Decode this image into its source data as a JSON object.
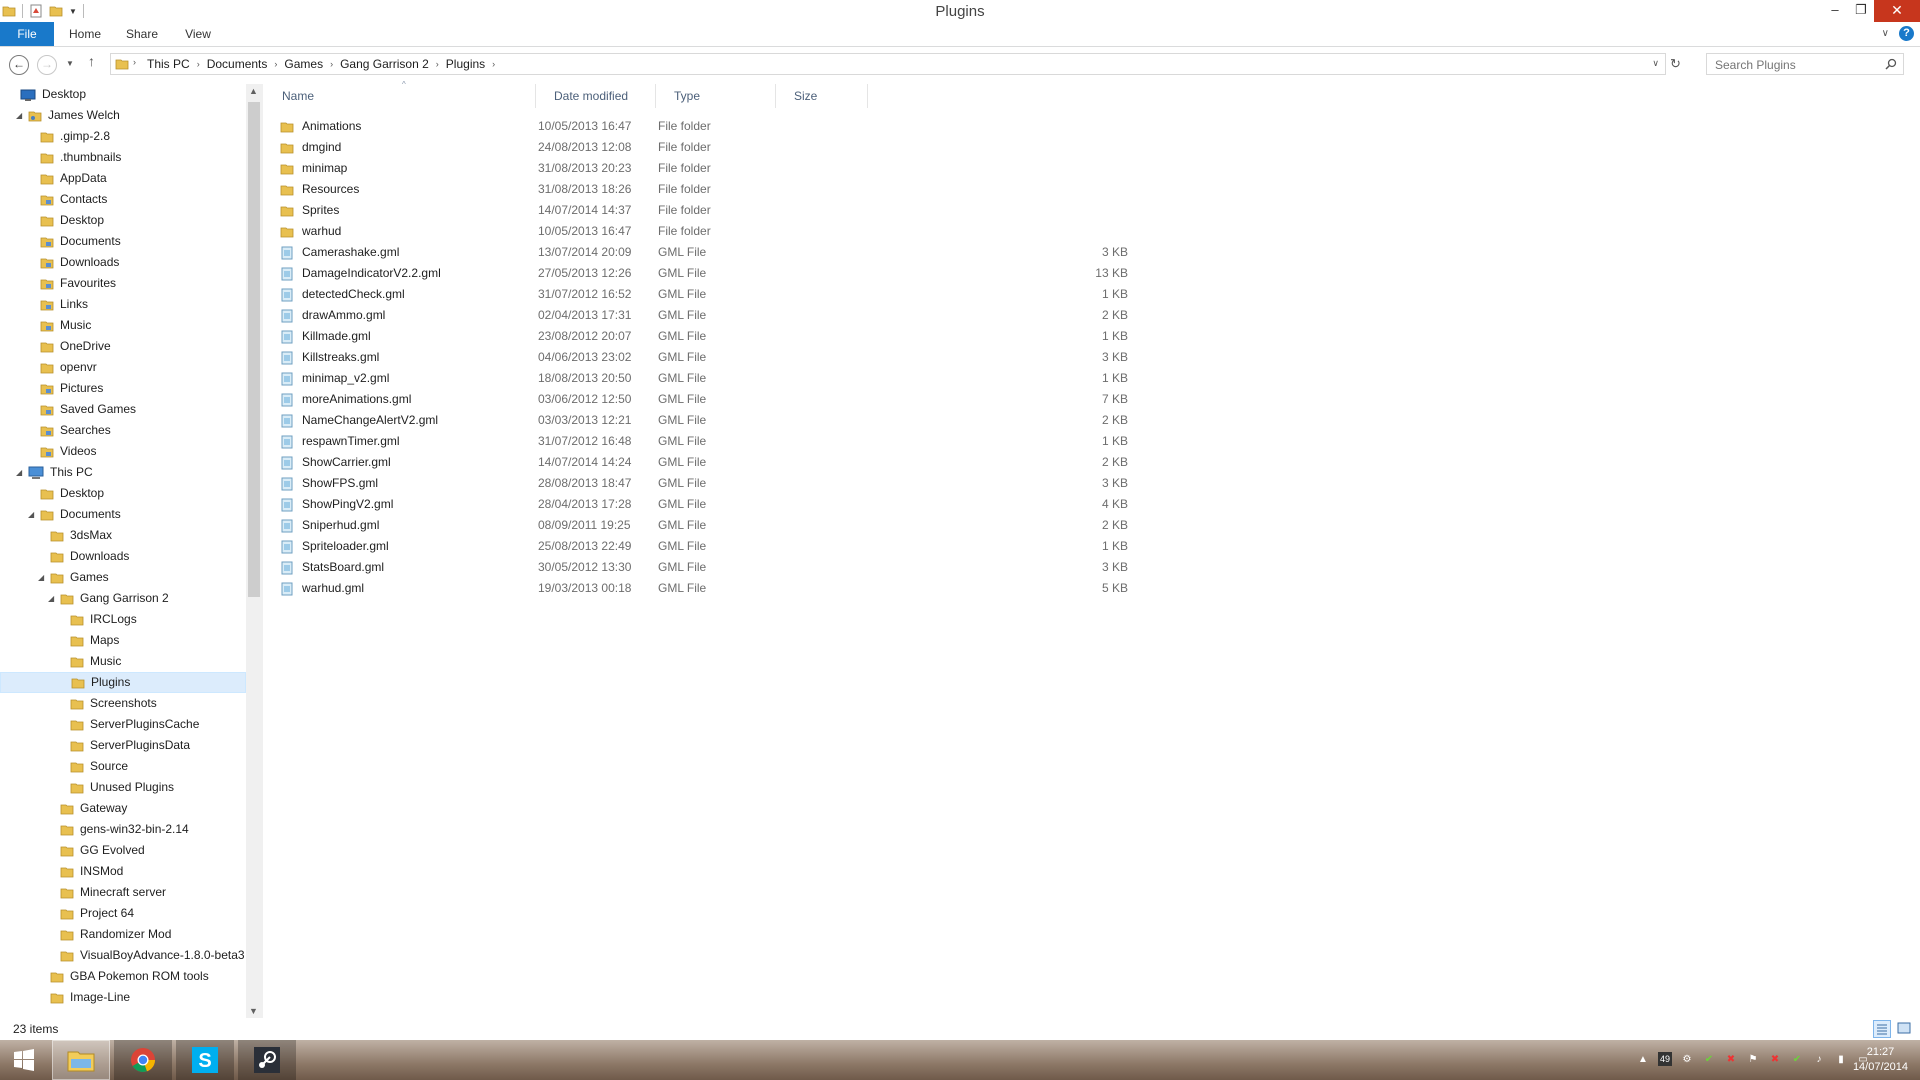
{
  "window": {
    "title": "Plugins"
  },
  "ribbon": {
    "tabs": [
      "File",
      "Home",
      "Share",
      "View"
    ]
  },
  "address": {
    "breadcrumbs": [
      "This PC",
      "Documents",
      "Games",
      "Gang Garrison 2",
      "Plugins"
    ],
    "search_placeholder": "Search Plugins"
  },
  "columns": {
    "name": "Name",
    "date": "Date modified",
    "type": "Type",
    "size": "Size"
  },
  "nav_tree": [
    {
      "label": "Desktop",
      "icon": "desktop-icon"
    },
    {
      "label": "James Welch",
      "icon": "user-folder-icon"
    },
    {
      "label": ".gimp-2.8",
      "icon": "folder-icon"
    },
    {
      "label": ".thumbnails",
      "icon": "folder-icon"
    },
    {
      "label": "AppData",
      "icon": "folder-icon"
    },
    {
      "label": "Contacts",
      "icon": "contacts-icon"
    },
    {
      "label": "Desktop",
      "icon": "folder-icon"
    },
    {
      "label": "Documents",
      "icon": "documents-icon"
    },
    {
      "label": "Downloads",
      "icon": "downloads-icon"
    },
    {
      "label": "Favourites",
      "icon": "favourites-icon"
    },
    {
      "label": "Links",
      "icon": "links-icon"
    },
    {
      "label": "Music",
      "icon": "music-icon"
    },
    {
      "label": "OneDrive",
      "icon": "folder-icon"
    },
    {
      "label": "openvr",
      "icon": "folder-icon"
    },
    {
      "label": "Pictures",
      "icon": "pictures-icon"
    },
    {
      "label": "Saved Games",
      "icon": "saved-games-icon"
    },
    {
      "label": "Searches",
      "icon": "searches-icon"
    },
    {
      "label": "Videos",
      "icon": "videos-icon"
    },
    {
      "label": "This PC",
      "icon": "computer-icon"
    },
    {
      "label": "Desktop",
      "icon": "folder-icon"
    },
    {
      "label": "Documents",
      "icon": "folder-icon"
    },
    {
      "label": "3dsMax",
      "icon": "folder-icon"
    },
    {
      "label": "Downloads",
      "icon": "folder-icon"
    },
    {
      "label": "Games",
      "icon": "folder-icon"
    },
    {
      "label": "Gang Garrison 2",
      "icon": "folder-icon"
    },
    {
      "label": "IRCLogs",
      "icon": "folder-icon"
    },
    {
      "label": "Maps",
      "icon": "folder-icon"
    },
    {
      "label": "Music",
      "icon": "folder-icon"
    },
    {
      "label": "Plugins",
      "icon": "folder-icon",
      "selected": true
    },
    {
      "label": "Screenshots",
      "icon": "folder-icon"
    },
    {
      "label": "ServerPluginsCache",
      "icon": "folder-icon"
    },
    {
      "label": "ServerPluginsData",
      "icon": "folder-icon"
    },
    {
      "label": "Source",
      "icon": "folder-icon"
    },
    {
      "label": "Unused Plugins",
      "icon": "folder-icon"
    },
    {
      "label": "Gateway",
      "icon": "folder-icon"
    },
    {
      "label": "gens-win32-bin-2.14",
      "icon": "folder-icon"
    },
    {
      "label": "GG Evolved",
      "icon": "folder-icon"
    },
    {
      "label": "INSMod",
      "icon": "folder-icon"
    },
    {
      "label": "Minecraft server",
      "icon": "folder-icon"
    },
    {
      "label": "Project 64",
      "icon": "folder-icon"
    },
    {
      "label": "Randomizer Mod",
      "icon": "folder-icon"
    },
    {
      "label": "VisualBoyAdvance-1.8.0-beta3",
      "icon": "folder-icon"
    },
    {
      "label": "GBA Pokemon ROM tools",
      "icon": "folder-icon"
    },
    {
      "label": "Image-Line",
      "icon": "folder-icon"
    }
  ],
  "files": [
    {
      "name": "Animations",
      "date": "10/05/2013 16:47",
      "type": "File folder",
      "size": "",
      "icon": "folder-icon"
    },
    {
      "name": "dmgind",
      "date": "24/08/2013 12:08",
      "type": "File folder",
      "size": "",
      "icon": "folder-icon"
    },
    {
      "name": "minimap",
      "date": "31/08/2013 20:23",
      "type": "File folder",
      "size": "",
      "icon": "folder-icon"
    },
    {
      "name": "Resources",
      "date": "31/08/2013 18:26",
      "type": "File folder",
      "size": "",
      "icon": "folder-icon"
    },
    {
      "name": "Sprites",
      "date": "14/07/2014 14:37",
      "type": "File folder",
      "size": "",
      "icon": "folder-icon"
    },
    {
      "name": "warhud",
      "date": "10/05/2013 16:47",
      "type": "File folder",
      "size": "",
      "icon": "folder-icon"
    },
    {
      "name": "Camerashake.gml",
      "date": "13/07/2014 20:09",
      "type": "GML File",
      "size": "3 KB",
      "icon": "gml-file-icon"
    },
    {
      "name": "DamageIndicatorV2.2.gml",
      "date": "27/05/2013 12:26",
      "type": "GML File",
      "size": "13 KB",
      "icon": "gml-file-icon"
    },
    {
      "name": "detectedCheck.gml",
      "date": "31/07/2012 16:52",
      "type": "GML File",
      "size": "1 KB",
      "icon": "gml-file-icon"
    },
    {
      "name": "drawAmmo.gml",
      "date": "02/04/2013 17:31",
      "type": "GML File",
      "size": "2 KB",
      "icon": "gml-file-icon"
    },
    {
      "name": "Killmade.gml",
      "date": "23/08/2012 20:07",
      "type": "GML File",
      "size": "1 KB",
      "icon": "gml-file-icon"
    },
    {
      "name": "Killstreaks.gml",
      "date": "04/06/2013 23:02",
      "type": "GML File",
      "size": "3 KB",
      "icon": "gml-file-icon"
    },
    {
      "name": "minimap_v2.gml",
      "date": "18/08/2013 20:50",
      "type": "GML File",
      "size": "1 KB",
      "icon": "gml-file-icon"
    },
    {
      "name": "moreAnimations.gml",
      "date": "03/06/2012 12:50",
      "type": "GML File",
      "size": "7 KB",
      "icon": "gml-file-icon"
    },
    {
      "name": "NameChangeAlertV2.gml",
      "date": "03/03/2013 12:21",
      "type": "GML File",
      "size": "2 KB",
      "icon": "gml-file-icon"
    },
    {
      "name": "respawnTimer.gml",
      "date": "31/07/2012 16:48",
      "type": "GML File",
      "size": "1 KB",
      "icon": "gml-file-icon"
    },
    {
      "name": "ShowCarrier.gml",
      "date": "14/07/2014 14:24",
      "type": "GML File",
      "size": "2 KB",
      "icon": "gml-file-icon"
    },
    {
      "name": "ShowFPS.gml",
      "date": "28/08/2013 18:47",
      "type": "GML File",
      "size": "3 KB",
      "icon": "gml-file-icon"
    },
    {
      "name": "ShowPingV2.gml",
      "date": "28/04/2013 17:28",
      "type": "GML File",
      "size": "4 KB",
      "icon": "gml-file-icon"
    },
    {
      "name": "Sniperhud.gml",
      "date": "08/09/2011 19:25",
      "type": "GML File",
      "size": "2 KB",
      "icon": "gml-file-icon"
    },
    {
      "name": "Spriteloader.gml",
      "date": "25/08/2013 22:49",
      "type": "GML File",
      "size": "1 KB",
      "icon": "gml-file-icon"
    },
    {
      "name": "StatsBoard.gml",
      "date": "30/05/2012 13:30",
      "type": "GML File",
      "size": "3 KB",
      "icon": "gml-file-icon"
    },
    {
      "name": "warhud.gml",
      "date": "19/03/2013 00:18",
      "type": "GML File",
      "size": "5 KB",
      "icon": "gml-file-icon"
    }
  ],
  "status": {
    "item_count": "23 items"
  },
  "taskbar": {
    "apps": [
      {
        "name": "start-button",
        "icon": "windows-logo-icon"
      },
      {
        "name": "file-explorer",
        "icon": "file-explorer-icon"
      },
      {
        "name": "chrome",
        "icon": "chrome-icon"
      },
      {
        "name": "skype",
        "icon": "skype-icon"
      },
      {
        "name": "steam",
        "icon": "steam-icon"
      }
    ],
    "tray_badge": "49",
    "time": "21:27",
    "date": "14/07/2014"
  },
  "colors": {
    "accent": "#1979ca",
    "selection": "#dcecfc",
    "folder": "#e8c050",
    "close": "#c7361d"
  }
}
